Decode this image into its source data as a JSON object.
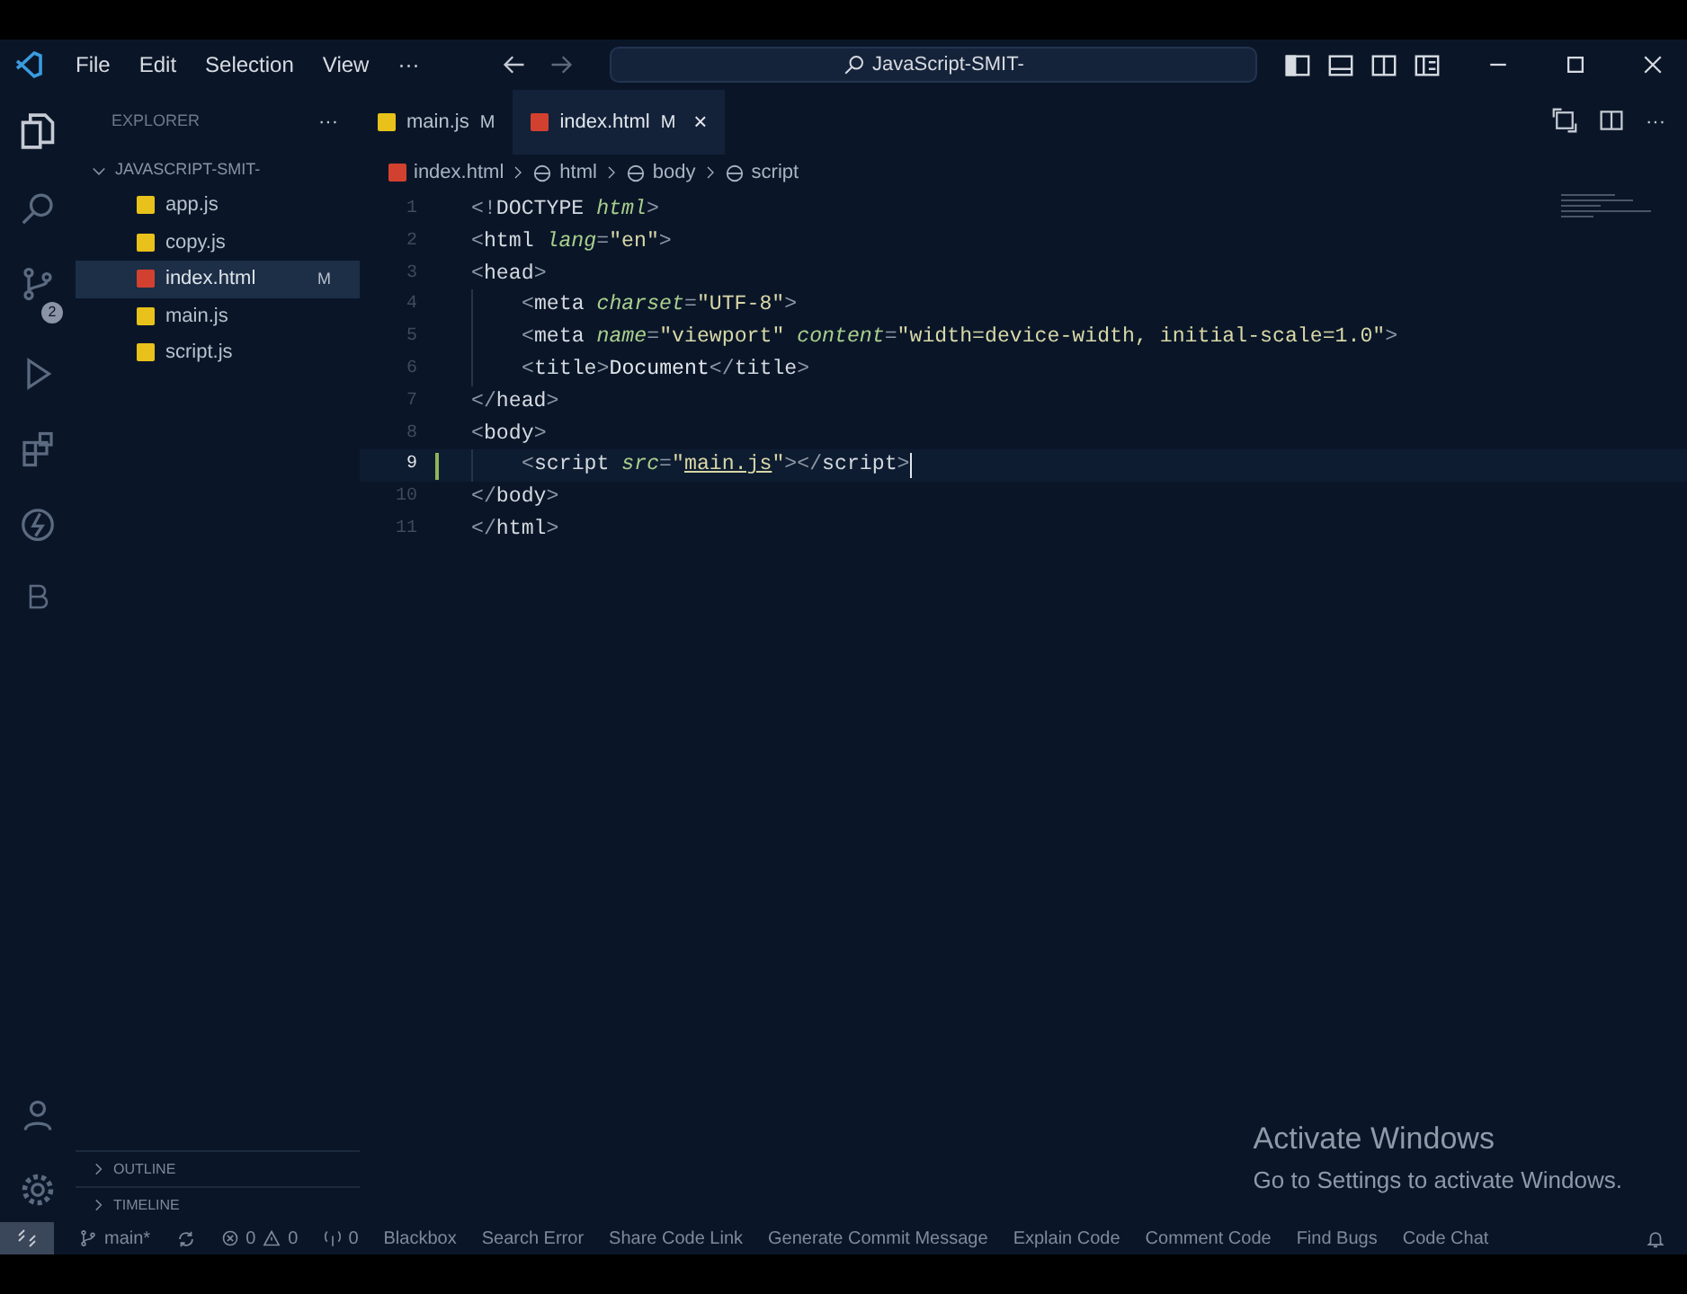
{
  "title_bar": {
    "menus": [
      "File",
      "Edit",
      "Selection",
      "View",
      "···"
    ],
    "search": {
      "value": "JavaScript-SMIT-"
    }
  },
  "activity_bar": {
    "source_control_badge": "2"
  },
  "sidebar": {
    "title": "EXPLORER",
    "more": "···",
    "folder": {
      "name": "JAVASCRIPT-SMIT-",
      "expanded": true,
      "files": [
        {
          "name": "app.js",
          "kind": "js",
          "selected": false
        },
        {
          "name": "copy.js",
          "kind": "js",
          "selected": false
        },
        {
          "name": "index.html",
          "kind": "html",
          "selected": true,
          "badge": "M"
        },
        {
          "name": "main.js",
          "kind": "js",
          "selected": false
        },
        {
          "name": "script.js",
          "kind": "js",
          "selected": false
        }
      ]
    },
    "sections": [
      {
        "name": "OUTLINE",
        "expanded": false
      },
      {
        "name": "TIMELINE",
        "expanded": false
      }
    ]
  },
  "tabs": [
    {
      "label": "main.js",
      "kind": "js",
      "badge": "M",
      "selected": false
    },
    {
      "label": "index.html",
      "kind": "html",
      "badge": "M",
      "selected": true,
      "close": "×"
    }
  ],
  "breadcrumb": [
    "index.html",
    "html",
    "body",
    "script"
  ],
  "editor": {
    "lines": [
      {
        "number": "1",
        "indented": false,
        "current": false,
        "tokens": [
          {
            "kind": "punct",
            "text": "<!"
          },
          {
            "kind": "tag",
            "text": "DOCTYPE "
          },
          {
            "kind": "attr",
            "text": "html"
          },
          {
            "kind": "punct",
            "text": ">"
          }
        ]
      },
      {
        "number": "2",
        "indented": false,
        "current": false,
        "tokens": [
          {
            "kind": "punct",
            "text": "<"
          },
          {
            "kind": "tag",
            "text": "html "
          },
          {
            "kind": "attr",
            "text": "lang"
          },
          {
            "kind": "punct",
            "text": "="
          },
          {
            "kind": "str",
            "text": "\"en\""
          },
          {
            "kind": "punct",
            "text": ">"
          }
        ]
      },
      {
        "number": "3",
        "indented": false,
        "current": false,
        "tokens": [
          {
            "kind": "punct",
            "text": "<"
          },
          {
            "kind": "tag",
            "text": "head"
          },
          {
            "kind": "punct",
            "text": ">"
          }
        ]
      },
      {
        "number": "4",
        "indented": true,
        "current": false,
        "tokens": [
          {
            "kind": "punct",
            "text": "<"
          },
          {
            "kind": "tag",
            "text": "meta "
          },
          {
            "kind": "attr",
            "text": "charset"
          },
          {
            "kind": "punct",
            "text": "="
          },
          {
            "kind": "str",
            "text": "\"UTF-8\""
          },
          {
            "kind": "punct",
            "text": ">"
          }
        ]
      },
      {
        "number": "5",
        "indented": true,
        "current": false,
        "tokens": [
          {
            "kind": "punct",
            "text": "<"
          },
          {
            "kind": "tag",
            "text": "meta "
          },
          {
            "kind": "attr",
            "text": "name"
          },
          {
            "kind": "punct",
            "text": "="
          },
          {
            "kind": "str",
            "text": "\"viewport\" "
          },
          {
            "kind": "attr",
            "text": "content"
          },
          {
            "kind": "punct",
            "text": "="
          },
          {
            "kind": "str",
            "text": "\"width=device-width, initial-scale=1.0\""
          },
          {
            "kind": "punct",
            "text": ">"
          }
        ]
      },
      {
        "number": "6",
        "indented": true,
        "current": false,
        "tokens": [
          {
            "kind": "punct",
            "text": "<"
          },
          {
            "kind": "tag",
            "text": "title"
          },
          {
            "kind": "punct",
            "text": ">"
          },
          {
            "kind": "text",
            "text": "Document"
          },
          {
            "kind": "punct",
            "text": "</"
          },
          {
            "kind": "tag",
            "text": "title"
          },
          {
            "kind": "punct",
            "text": ">"
          }
        ]
      },
      {
        "number": "7",
        "indented": false,
        "current": false,
        "tokens": [
          {
            "kind": "punct",
            "text": "</"
          },
          {
            "kind": "tag",
            "text": "head"
          },
          {
            "kind": "punct",
            "text": ">"
          }
        ]
      },
      {
        "number": "8",
        "indented": false,
        "current": false,
        "tokens": [
          {
            "kind": "punct",
            "text": "<"
          },
          {
            "kind": "tag",
            "text": "body"
          },
          {
            "kind": "punct",
            "text": ">"
          }
        ]
      },
      {
        "number": "9",
        "indented": true,
        "current": true,
        "tokens": [
          {
            "kind": "punct",
            "text": "<"
          },
          {
            "kind": "tag",
            "text": "script "
          },
          {
            "kind": "attr",
            "text": "src"
          },
          {
            "kind": "punct",
            "text": "="
          },
          {
            "kind": "str",
            "text": "\""
          },
          {
            "kind": "link",
            "text": "main.js"
          },
          {
            "kind": "str",
            "text": "\""
          },
          {
            "kind": "punct",
            "text": "></"
          },
          {
            "kind": "tag",
            "text": "script"
          },
          {
            "kind": "punct",
            "text": ">"
          }
        ]
      },
      {
        "number": "10",
        "indented": false,
        "current": false,
        "tokens": [
          {
            "kind": "punct",
            "text": "</"
          },
          {
            "kind": "tag",
            "text": "body"
          },
          {
            "kind": "punct",
            "text": ">"
          }
        ]
      },
      {
        "number": "11",
        "indented": false,
        "current": false,
        "tokens": [
          {
            "kind": "punct",
            "text": "</"
          },
          {
            "kind": "tag",
            "text": "html"
          },
          {
            "kind": "punct",
            "text": ">"
          }
        ]
      }
    ]
  },
  "activation_notice": {
    "title": "Activate Windows",
    "message": "Go to Settings to activate Windows."
  },
  "status_bar": {
    "branch": "main*",
    "problems": [
      {
        "kind": "error",
        "count": "0"
      },
      {
        "kind": "warning",
        "count": "0"
      }
    ],
    "ports": "0",
    "items": [
      "Blackbox",
      "Search Error",
      "Share Code Link",
      "Generate Commit Message",
      "Explain Code",
      "Comment Code",
      "Find Bugs",
      "Code Chat"
    ]
  }
}
